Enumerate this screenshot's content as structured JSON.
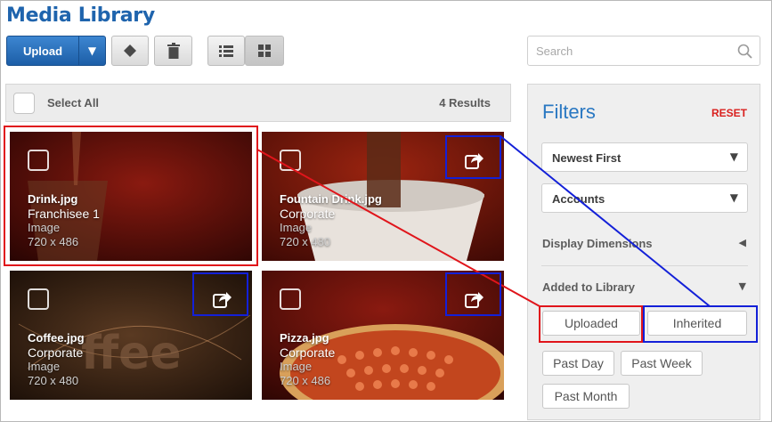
{
  "page": {
    "title": "Media Library"
  },
  "toolbar": {
    "upload_label": "Upload",
    "upload_caret_icon": "triangle-down-icon",
    "edit_icon": "tag-icon",
    "delete_icon": "trash-icon",
    "list_view_icon": "list-view-icon",
    "grid_view_icon": "grid-view-icon"
  },
  "search": {
    "placeholder": "Search",
    "value": "",
    "icon": "search-icon"
  },
  "selection_bar": {
    "select_all_label": "Select All",
    "results_label": "4 Results"
  },
  "media": [
    {
      "file_name": "Drink.jpg",
      "owner": "Franchisee 1",
      "type": "Image",
      "dimensions": "720 x 486",
      "shareable": false
    },
    {
      "file_name": "Fountain Drink.jpg",
      "owner": "Corporate",
      "type": "Image",
      "dimensions": "720 x 480",
      "shareable": true
    },
    {
      "file_name": "Coffee.jpg",
      "owner": "Corporate",
      "type": "Image",
      "dimensions": "720 x 480",
      "shareable": true
    },
    {
      "file_name": "Pizza.jpg",
      "owner": "Corporate",
      "type": "Image",
      "dimensions": "720 x 486",
      "shareable": true
    }
  ],
  "filters": {
    "title": "Filters",
    "reset_label": "RESET",
    "sort_select": "Newest First",
    "accounts_select": "Accounts",
    "display_dimensions_label": "Display Dimensions",
    "added_to_library_label": "Added to Library",
    "source_options": [
      "Uploaded",
      "Inherited"
    ],
    "date_options": [
      "Past Day",
      "Past Week",
      "Past Month"
    ]
  },
  "annotation_colors": {
    "red": "#e0151b",
    "blue": "#1320d8"
  },
  "colors": {
    "brand_blue": "#1f64ad",
    "accent_blue": "#2a78c2",
    "reset_red": "#d9201e"
  }
}
